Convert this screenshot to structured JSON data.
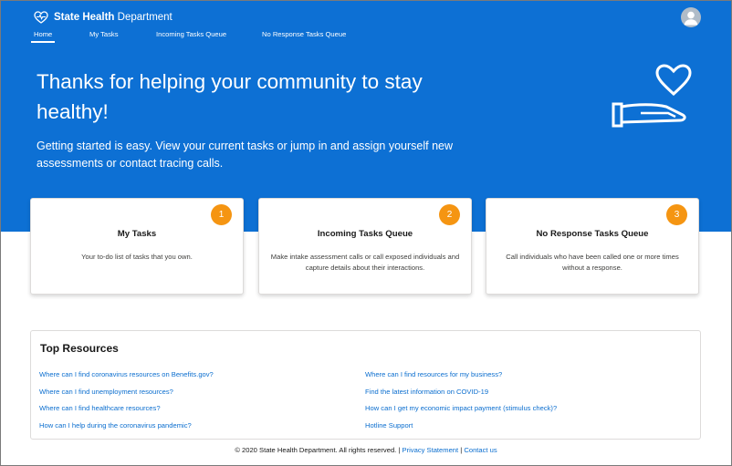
{
  "header": {
    "brand_bold": "State Health",
    "brand_rest": "Department",
    "nav": [
      {
        "label": "Home",
        "active": true
      },
      {
        "label": "My Tasks",
        "active": false
      },
      {
        "label": "Incoming Tasks Queue",
        "active": false
      },
      {
        "label": "No Response Tasks Queue",
        "active": false
      }
    ]
  },
  "hero": {
    "title": "Thanks for helping your community to stay healthy!",
    "subtitle": "Getting started is easy. View your current tasks or jump in and assign yourself new assessments or contact tracing calls."
  },
  "cards": [
    {
      "badge": "1",
      "title": "My Tasks",
      "description": "Your to-do list of tasks that you own."
    },
    {
      "badge": "2",
      "title": "Incoming Tasks Queue",
      "description": "Make intake assessment calls or call exposed individuals and capture details about their interactions."
    },
    {
      "badge": "3",
      "title": "No Response Tasks Queue",
      "description": "Call individuals who have been called one or more times without a response."
    }
  ],
  "resources": {
    "title": "Top Resources",
    "left_links": [
      "Where can I find coronavirus resources on Benefits.gov?",
      "Where can I find unemployment resources?",
      "Where can I find healthcare resources?",
      "How can I help during the coronavirus pandemic?"
    ],
    "right_links": [
      "Where can I find resources for my business?",
      "Find the latest information on COVID-19",
      "How can I get my economic impact payment (stimulus check)?",
      "Hotline Support"
    ]
  },
  "footer": {
    "copyright": "© 2020 State Health Department. All rights reserved.",
    "separator": "|",
    "privacy": "Privacy Statement",
    "contact": "Contact us"
  },
  "colors": {
    "brand_blue": "#0d70d4",
    "badge_orange": "#f59512",
    "link_blue": "#0b6ecf"
  },
  "icons": {
    "brand": "heart-pulse-icon",
    "avatar": "user-avatar-icon",
    "hero": "hand-holding-heart-icon"
  }
}
